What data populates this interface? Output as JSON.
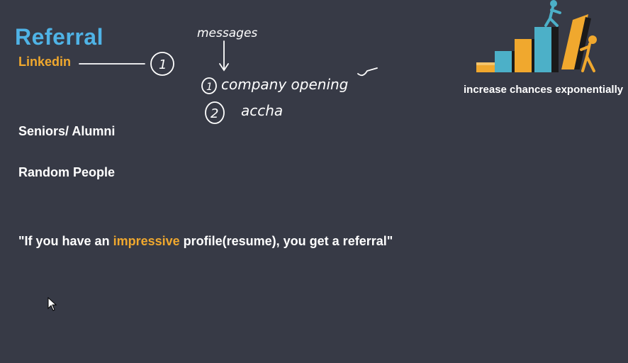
{
  "slide": {
    "title": "Referral",
    "subtitle": "Linkedin",
    "items": [
      "Seniors/ Alumni",
      "Random People"
    ],
    "quote": {
      "before": "\"If you have an ",
      "highlight": "impressive",
      "after": " profile(resume), you get a referral\""
    },
    "caption": "increase chances exponentially"
  },
  "annotations": {
    "circle_1": "1",
    "messages": "messages",
    "item1_num": "1",
    "item1_text": "company opening",
    "item2_num": "2",
    "item2_text": "accha"
  },
  "colors": {
    "background": "#373a46",
    "title": "#4fb3e6",
    "accent": "#f0a82e",
    "text": "#ffffff"
  },
  "icons": [
    "growth-stairs-illustration",
    "mouse-cursor-icon"
  ]
}
